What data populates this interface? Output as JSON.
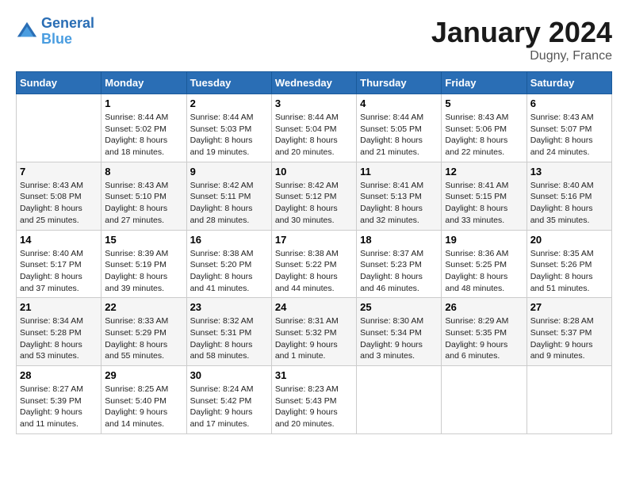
{
  "header": {
    "logo_line1": "General",
    "logo_line2": "Blue",
    "month": "January 2024",
    "location": "Dugny, France"
  },
  "columns": [
    "Sunday",
    "Monday",
    "Tuesday",
    "Wednesday",
    "Thursday",
    "Friday",
    "Saturday"
  ],
  "weeks": [
    [
      {
        "day": "",
        "sunrise": "",
        "sunset": "",
        "daylight": ""
      },
      {
        "day": "1",
        "sunrise": "Sunrise: 8:44 AM",
        "sunset": "Sunset: 5:02 PM",
        "daylight": "Daylight: 8 hours and 18 minutes."
      },
      {
        "day": "2",
        "sunrise": "Sunrise: 8:44 AM",
        "sunset": "Sunset: 5:03 PM",
        "daylight": "Daylight: 8 hours and 19 minutes."
      },
      {
        "day": "3",
        "sunrise": "Sunrise: 8:44 AM",
        "sunset": "Sunset: 5:04 PM",
        "daylight": "Daylight: 8 hours and 20 minutes."
      },
      {
        "day": "4",
        "sunrise": "Sunrise: 8:44 AM",
        "sunset": "Sunset: 5:05 PM",
        "daylight": "Daylight: 8 hours and 21 minutes."
      },
      {
        "day": "5",
        "sunrise": "Sunrise: 8:43 AM",
        "sunset": "Sunset: 5:06 PM",
        "daylight": "Daylight: 8 hours and 22 minutes."
      },
      {
        "day": "6",
        "sunrise": "Sunrise: 8:43 AM",
        "sunset": "Sunset: 5:07 PM",
        "daylight": "Daylight: 8 hours and 24 minutes."
      }
    ],
    [
      {
        "day": "7",
        "sunrise": "Sunrise: 8:43 AM",
        "sunset": "Sunset: 5:08 PM",
        "daylight": "Daylight: 8 hours and 25 minutes."
      },
      {
        "day": "8",
        "sunrise": "Sunrise: 8:43 AM",
        "sunset": "Sunset: 5:10 PM",
        "daylight": "Daylight: 8 hours and 27 minutes."
      },
      {
        "day": "9",
        "sunrise": "Sunrise: 8:42 AM",
        "sunset": "Sunset: 5:11 PM",
        "daylight": "Daylight: 8 hours and 28 minutes."
      },
      {
        "day": "10",
        "sunrise": "Sunrise: 8:42 AM",
        "sunset": "Sunset: 5:12 PM",
        "daylight": "Daylight: 8 hours and 30 minutes."
      },
      {
        "day": "11",
        "sunrise": "Sunrise: 8:41 AM",
        "sunset": "Sunset: 5:13 PM",
        "daylight": "Daylight: 8 hours and 32 minutes."
      },
      {
        "day": "12",
        "sunrise": "Sunrise: 8:41 AM",
        "sunset": "Sunset: 5:15 PM",
        "daylight": "Daylight: 8 hours and 33 minutes."
      },
      {
        "day": "13",
        "sunrise": "Sunrise: 8:40 AM",
        "sunset": "Sunset: 5:16 PM",
        "daylight": "Daylight: 8 hours and 35 minutes."
      }
    ],
    [
      {
        "day": "14",
        "sunrise": "Sunrise: 8:40 AM",
        "sunset": "Sunset: 5:17 PM",
        "daylight": "Daylight: 8 hours and 37 minutes."
      },
      {
        "day": "15",
        "sunrise": "Sunrise: 8:39 AM",
        "sunset": "Sunset: 5:19 PM",
        "daylight": "Daylight: 8 hours and 39 minutes."
      },
      {
        "day": "16",
        "sunrise": "Sunrise: 8:38 AM",
        "sunset": "Sunset: 5:20 PM",
        "daylight": "Daylight: 8 hours and 41 minutes."
      },
      {
        "day": "17",
        "sunrise": "Sunrise: 8:38 AM",
        "sunset": "Sunset: 5:22 PM",
        "daylight": "Daylight: 8 hours and 44 minutes."
      },
      {
        "day": "18",
        "sunrise": "Sunrise: 8:37 AM",
        "sunset": "Sunset: 5:23 PM",
        "daylight": "Daylight: 8 hours and 46 minutes."
      },
      {
        "day": "19",
        "sunrise": "Sunrise: 8:36 AM",
        "sunset": "Sunset: 5:25 PM",
        "daylight": "Daylight: 8 hours and 48 minutes."
      },
      {
        "day": "20",
        "sunrise": "Sunrise: 8:35 AM",
        "sunset": "Sunset: 5:26 PM",
        "daylight": "Daylight: 8 hours and 51 minutes."
      }
    ],
    [
      {
        "day": "21",
        "sunrise": "Sunrise: 8:34 AM",
        "sunset": "Sunset: 5:28 PM",
        "daylight": "Daylight: 8 hours and 53 minutes."
      },
      {
        "day": "22",
        "sunrise": "Sunrise: 8:33 AM",
        "sunset": "Sunset: 5:29 PM",
        "daylight": "Daylight: 8 hours and 55 minutes."
      },
      {
        "day": "23",
        "sunrise": "Sunrise: 8:32 AM",
        "sunset": "Sunset: 5:31 PM",
        "daylight": "Daylight: 8 hours and 58 minutes."
      },
      {
        "day": "24",
        "sunrise": "Sunrise: 8:31 AM",
        "sunset": "Sunset: 5:32 PM",
        "daylight": "Daylight: 9 hours and 1 minute."
      },
      {
        "day": "25",
        "sunrise": "Sunrise: 8:30 AM",
        "sunset": "Sunset: 5:34 PM",
        "daylight": "Daylight: 9 hours and 3 minutes."
      },
      {
        "day": "26",
        "sunrise": "Sunrise: 8:29 AM",
        "sunset": "Sunset: 5:35 PM",
        "daylight": "Daylight: 9 hours and 6 minutes."
      },
      {
        "day": "27",
        "sunrise": "Sunrise: 8:28 AM",
        "sunset": "Sunset: 5:37 PM",
        "daylight": "Daylight: 9 hours and 9 minutes."
      }
    ],
    [
      {
        "day": "28",
        "sunrise": "Sunrise: 8:27 AM",
        "sunset": "Sunset: 5:39 PM",
        "daylight": "Daylight: 9 hours and 11 minutes."
      },
      {
        "day": "29",
        "sunrise": "Sunrise: 8:25 AM",
        "sunset": "Sunset: 5:40 PM",
        "daylight": "Daylight: 9 hours and 14 minutes."
      },
      {
        "day": "30",
        "sunrise": "Sunrise: 8:24 AM",
        "sunset": "Sunset: 5:42 PM",
        "daylight": "Daylight: 9 hours and 17 minutes."
      },
      {
        "day": "31",
        "sunrise": "Sunrise: 8:23 AM",
        "sunset": "Sunset: 5:43 PM",
        "daylight": "Daylight: 9 hours and 20 minutes."
      },
      {
        "day": "",
        "sunrise": "",
        "sunset": "",
        "daylight": ""
      },
      {
        "day": "",
        "sunrise": "",
        "sunset": "",
        "daylight": ""
      },
      {
        "day": "",
        "sunrise": "",
        "sunset": "",
        "daylight": ""
      }
    ]
  ]
}
